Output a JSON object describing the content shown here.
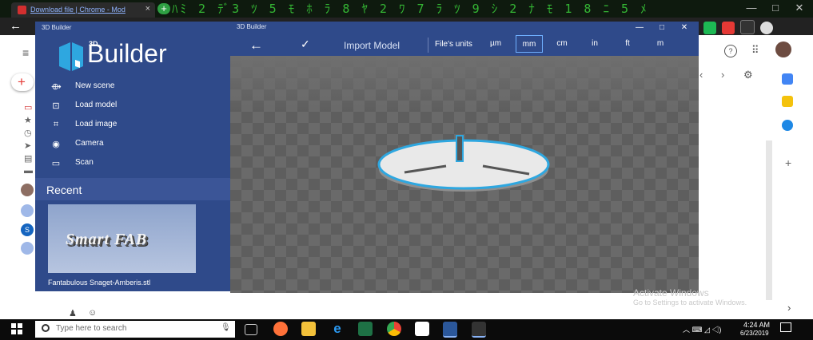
{
  "browser": {
    "tab_title": "Download file | Chrome - Mod",
    "tab_close": "×",
    "new_tab": "+",
    "back": "←",
    "matrix_text": "ﾊﾐ 2 ﾃﾞ3 ﾂ 5 ﾓ ﾎ ﾗ 8 ﾔ 2 ﾜ 7 ﾗ ﾂ 9 ｼ 2 ﾅ ﾓ 1 8 ﾆ 5 ﾒ",
    "window_controls": [
      "—",
      "□",
      "✕"
    ]
  },
  "page": {
    "right_icons": [
      "?",
      "⠿"
    ],
    "pager": [
      "‹",
      "›",
      "⚙"
    ],
    "right_rail_plus": "+",
    "right_chevron": "›",
    "left_nav_bottom": [
      "♟",
      "☺"
    ]
  },
  "sidebar": {
    "window_title": "3D Builder",
    "logo_3d": "3D",
    "logo_text": "Builder",
    "items": [
      {
        "icon": "⟴",
        "label": "New scene"
      },
      {
        "icon": "⊡",
        "label": "Load model"
      },
      {
        "icon": "⌗",
        "label": "Load image"
      },
      {
        "icon": "◉",
        "label": "Camera"
      },
      {
        "icon": "▭",
        "label": "Scan"
      }
    ],
    "recent_label": "Recent",
    "thumb_text": "Smart FAB",
    "recent_file": "Fantabulous Snaget-Amberis.stl"
  },
  "main": {
    "window_title": "3D Builder",
    "controls": [
      "—",
      "□",
      "✕"
    ],
    "back_icon": "←",
    "confirm_icon": "✓",
    "import_label": "Import Model",
    "units_label": "File's units",
    "units": [
      "µm",
      "mm",
      "cm",
      "in",
      "ft",
      "m"
    ],
    "selected_unit": "mm"
  },
  "watermark": {
    "line1": "Activate Windows",
    "line2": "Go to Settings to activate Windows."
  },
  "taskbar": {
    "search_placeholder": "Type here to search",
    "tray": "︿ ⌨ ◿ ◁)",
    "time": "4:24 AM",
    "date": "6/23/2019"
  },
  "colors": {
    "sidebar_bg": "#2f4a8a",
    "accent_blue": "#2ea7e0",
    "viewport_gray": "#5e5e5e"
  }
}
